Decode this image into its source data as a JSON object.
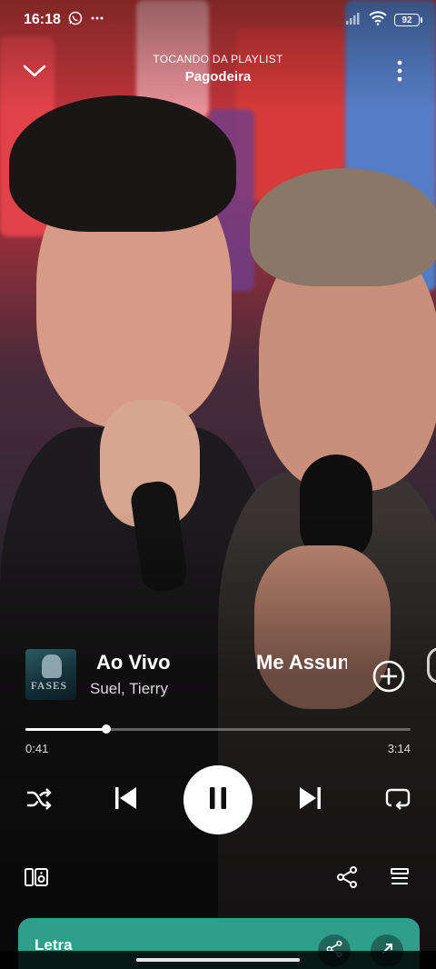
{
  "status_bar": {
    "time": "16:18",
    "battery": "92",
    "icons": [
      "whatsapp-icon",
      "more-notifications-icon",
      "signal-icon",
      "wifi-icon",
      "battery-icon"
    ]
  },
  "header": {
    "subtitle": "TOCANDO DA PLAYLIST",
    "playlist": "Pagodeira",
    "icons": [
      "chevron-down-icon",
      "more-vertical-icon"
    ]
  },
  "track": {
    "title": "Ao Vivo",
    "next_title": "Me Assun",
    "artist": "Suel, Tierry",
    "cover_text": "FASES"
  },
  "playback": {
    "current_time": "0:41",
    "total_time": "3:14",
    "progress_fraction": 0.21
  },
  "lyrics": {
    "title": "Letra"
  },
  "colors": {
    "accent": "#2f9e8a",
    "text": "#ffffff"
  }
}
